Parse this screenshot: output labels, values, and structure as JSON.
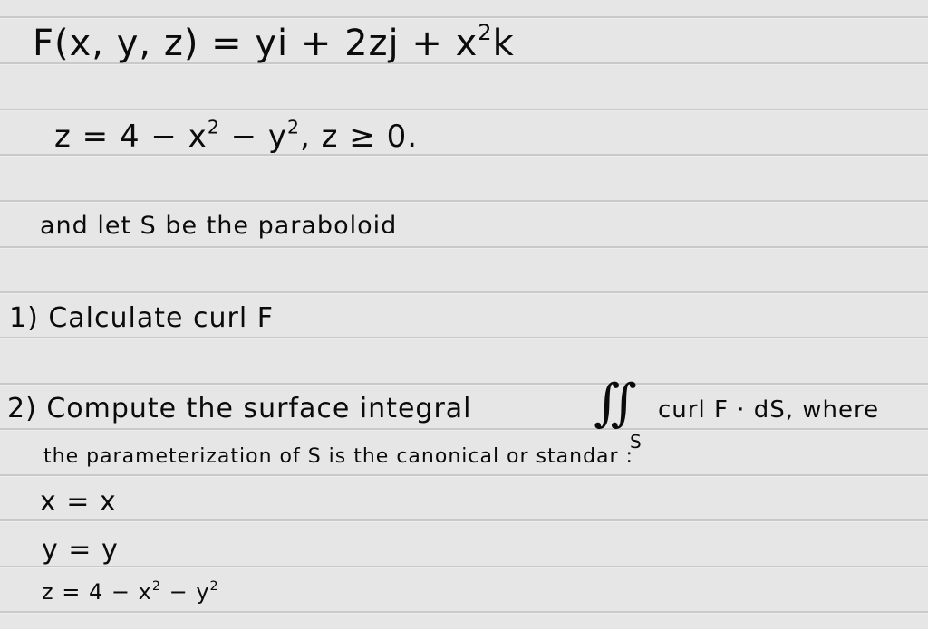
{
  "document": {
    "background_color": "#e6e6e6",
    "rule_color": "#c9c9c9",
    "ink_color": "#0b0b0b",
    "lines": {
      "field_definition": {
        "lhs": "F(x, y, z)",
        "equals": "=",
        "rhs_prefix": "yi + 2zj + x",
        "rhs_exp": "2",
        "rhs_suffix": "k"
      },
      "surface_equation": {
        "part1": "z = 4 − x",
        "exp1": "2",
        "part2": " − y",
        "exp2": "2",
        "part3": ",  z ≥ 0."
      },
      "surface_statement": "and  let  S  be  the  paraboloid",
      "task_1": "1) Calculate  curl  F",
      "task_2": {
        "before_integral": "2) Compute  the  surface  integral",
        "integral_symbol": "∬",
        "integral_subscript": "S",
        "after_integral": "curl F · dS,  where"
      },
      "task_2_continued": "the  parameterization  of  S  is  the  canonical  or  standar :",
      "param_x": "x = x",
      "param_y": "y = y",
      "param_z": {
        "prefix": "z = 4 − x",
        "exp1": "2",
        "mid": " − y",
        "exp2": "2"
      }
    }
  }
}
